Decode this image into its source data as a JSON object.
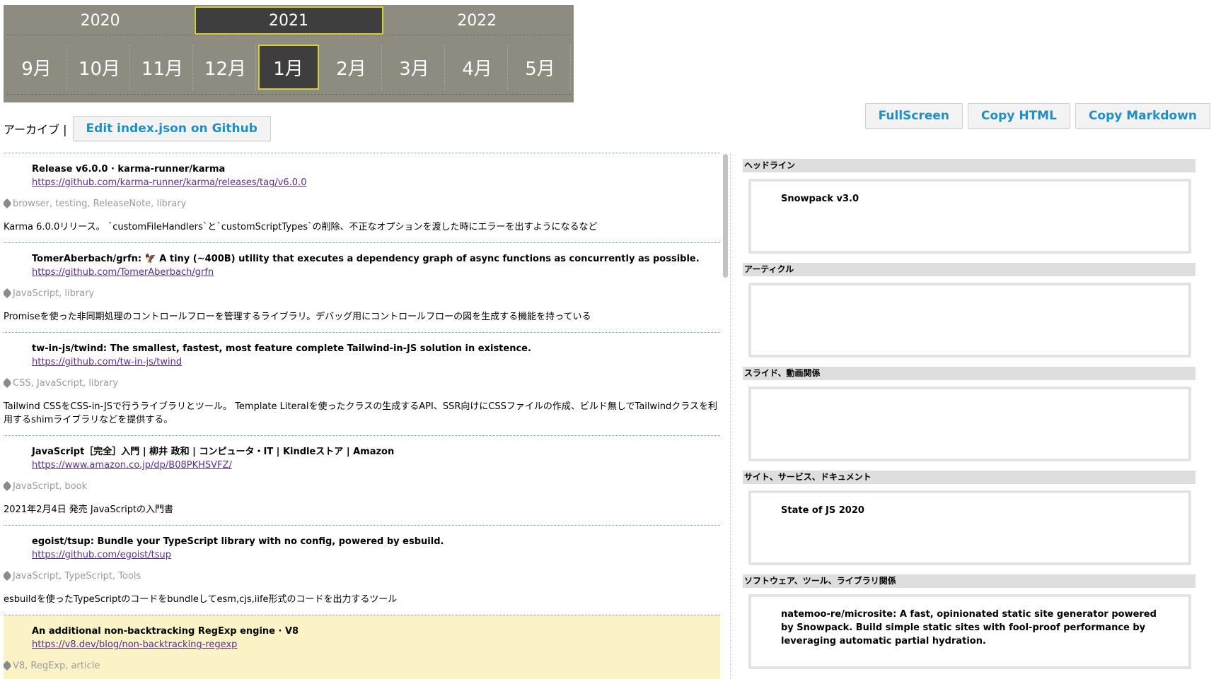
{
  "calendar": {
    "years": [
      {
        "label": "2020",
        "active": false
      },
      {
        "label": "2021",
        "active": true
      },
      {
        "label": "2022",
        "active": false
      }
    ],
    "months": [
      {
        "label": "9月",
        "active": false
      },
      {
        "label": "10月",
        "active": false
      },
      {
        "label": "11月",
        "active": false
      },
      {
        "label": "12月",
        "active": false
      },
      {
        "label": "1月",
        "active": true
      },
      {
        "label": "2月",
        "active": false
      },
      {
        "label": "3月",
        "active": false
      },
      {
        "label": "4月",
        "active": false
      },
      {
        "label": "5月",
        "active": false
      }
    ]
  },
  "archive": {
    "label": "アーカイブ |",
    "edit_button": "Edit index.json on Github"
  },
  "actions": {
    "fullscreen": "FullScreen",
    "copy_html": "Copy HTML",
    "copy_markdown": "Copy Markdown"
  },
  "entries": [
    {
      "title": "Release v6.0.0 · karma-runner/karma",
      "url": "https://github.com/karma-runner/karma/releases/tag/v6.0.0",
      "tags": "browser, testing, ReleaseNote, library",
      "desc": "Karma 6.0.0リリース。 `customFileHandlers`と`customScriptTypes`の削除、不正なオプションを渡した時にエラーを出すようになるなど"
    },
    {
      "title": "TomerAberbach/grfn: 🦅 A tiny (~400B) utility that executes a dependency graph of async functions as concurrently as possible.",
      "url": "https://github.com/TomerAberbach/grfn",
      "tags": "JavaScript, library",
      "desc": "Promiseを使った非同期処理のコントロールフローを管理するライブラリ。デバッグ用にコントロールフローの図を生成する機能を持っている"
    },
    {
      "title": "tw-in-js/twind: The smallest, fastest, most feature complete Tailwind-in-JS solution in existence.",
      "url": "https://github.com/tw-in-js/twind",
      "tags": "CSS, JavaScript, library",
      "desc": "Tailwind CSSをCSS-in-JSで行うライブラリとツール。 Template Literalを使ったクラスの生成するAPI、SSR向けにCSSファイルの作成、ビルド無しでTailwindクラスを利用するshimライブラリなどを提供する。"
    },
    {
      "title": "JavaScript［完全］入門 | 柳井 政和 | コンピュータ・IT | Kindleストア | Amazon",
      "url": "https://www.amazon.co.jp/dp/B08PKHSVFZ/",
      "tags": "JavaScript, book",
      "desc": "2021年2月4日 発売 JavaScriptの入門書"
    },
    {
      "title": "egoist/tsup: Bundle your TypeScript library with no config, powered by esbuild.",
      "url": "https://github.com/egoist/tsup",
      "tags": "JavaScript, TypeScript, Tools",
      "desc": "esbuildを使ったTypeScriptのコードをbundleしてesm,cjs,iife形式のコードを出力するツール"
    },
    {
      "title": "An additional non-backtracking RegExp engine · V8",
      "url": "https://v8.dev/blog/non-backtracking-regexp",
      "tags": "V8, RegExp, article",
      "desc": ""
    }
  ],
  "categories": [
    {
      "heading": "ヘッドライン",
      "items": [
        "Snowpack v3.0"
      ]
    },
    {
      "heading": "アーティクル",
      "items": []
    },
    {
      "heading": "スライド、動画関係",
      "items": []
    },
    {
      "heading": "サイト、サービス、ドキュメント",
      "items": [
        "State of JS 2020"
      ]
    },
    {
      "heading": "ソフトウェア、ツール、ライブラリ関係",
      "items": [
        "natemoo-re/microsite: A fast, opinionated static site generator powered by Snowpack. Build simple static sites with fool-proof performance by leveraging automatic partial hydration."
      ]
    }
  ],
  "colors": {
    "calendar_bg": "#8e8b80",
    "active_bg": "#3e3e3e",
    "active_outline": "#d5d03a",
    "button_text": "#1f8fc4",
    "highlight_bg": "#fbf3c6"
  },
  "icons": {
    "tag": "tag-icon"
  }
}
